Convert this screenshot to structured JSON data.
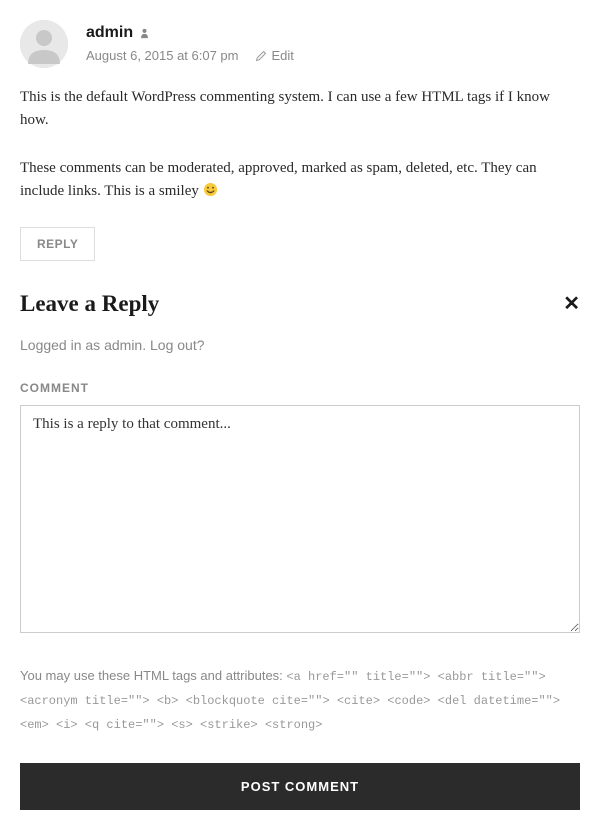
{
  "comment": {
    "author": "admin",
    "date": "August 6, 2015 at 6:07 pm",
    "edit_label": "Edit",
    "body_p1": "This is the default WordPress commenting system. I can use a few HTML tags if I know how.",
    "body_p2": "These comments can be moderated, approved, marked as spam, deleted, etc. They can include links. This is a smiley ",
    "reply_label": "REPLY"
  },
  "reply_form": {
    "title": "Leave a Reply",
    "logged_in_prefix": "Logged in as ",
    "logged_in_user": "admin",
    "logged_in_sep": ". ",
    "logout_label": "Log out?",
    "comment_label": "COMMENT",
    "comment_value": "This is a reply to that comment...",
    "tags_note_prefix": "You may use these HTML tags and attributes: ",
    "tags_note_code": "<a href=\"\" title=\"\"> <abbr title=\"\"> <acronym title=\"\"> <b> <blockquote cite=\"\"> <cite> <code> <del datetime=\"\"> <em> <i> <q cite=\"\"> <s> <strike> <strong>",
    "submit_label": "POST COMMENT"
  }
}
